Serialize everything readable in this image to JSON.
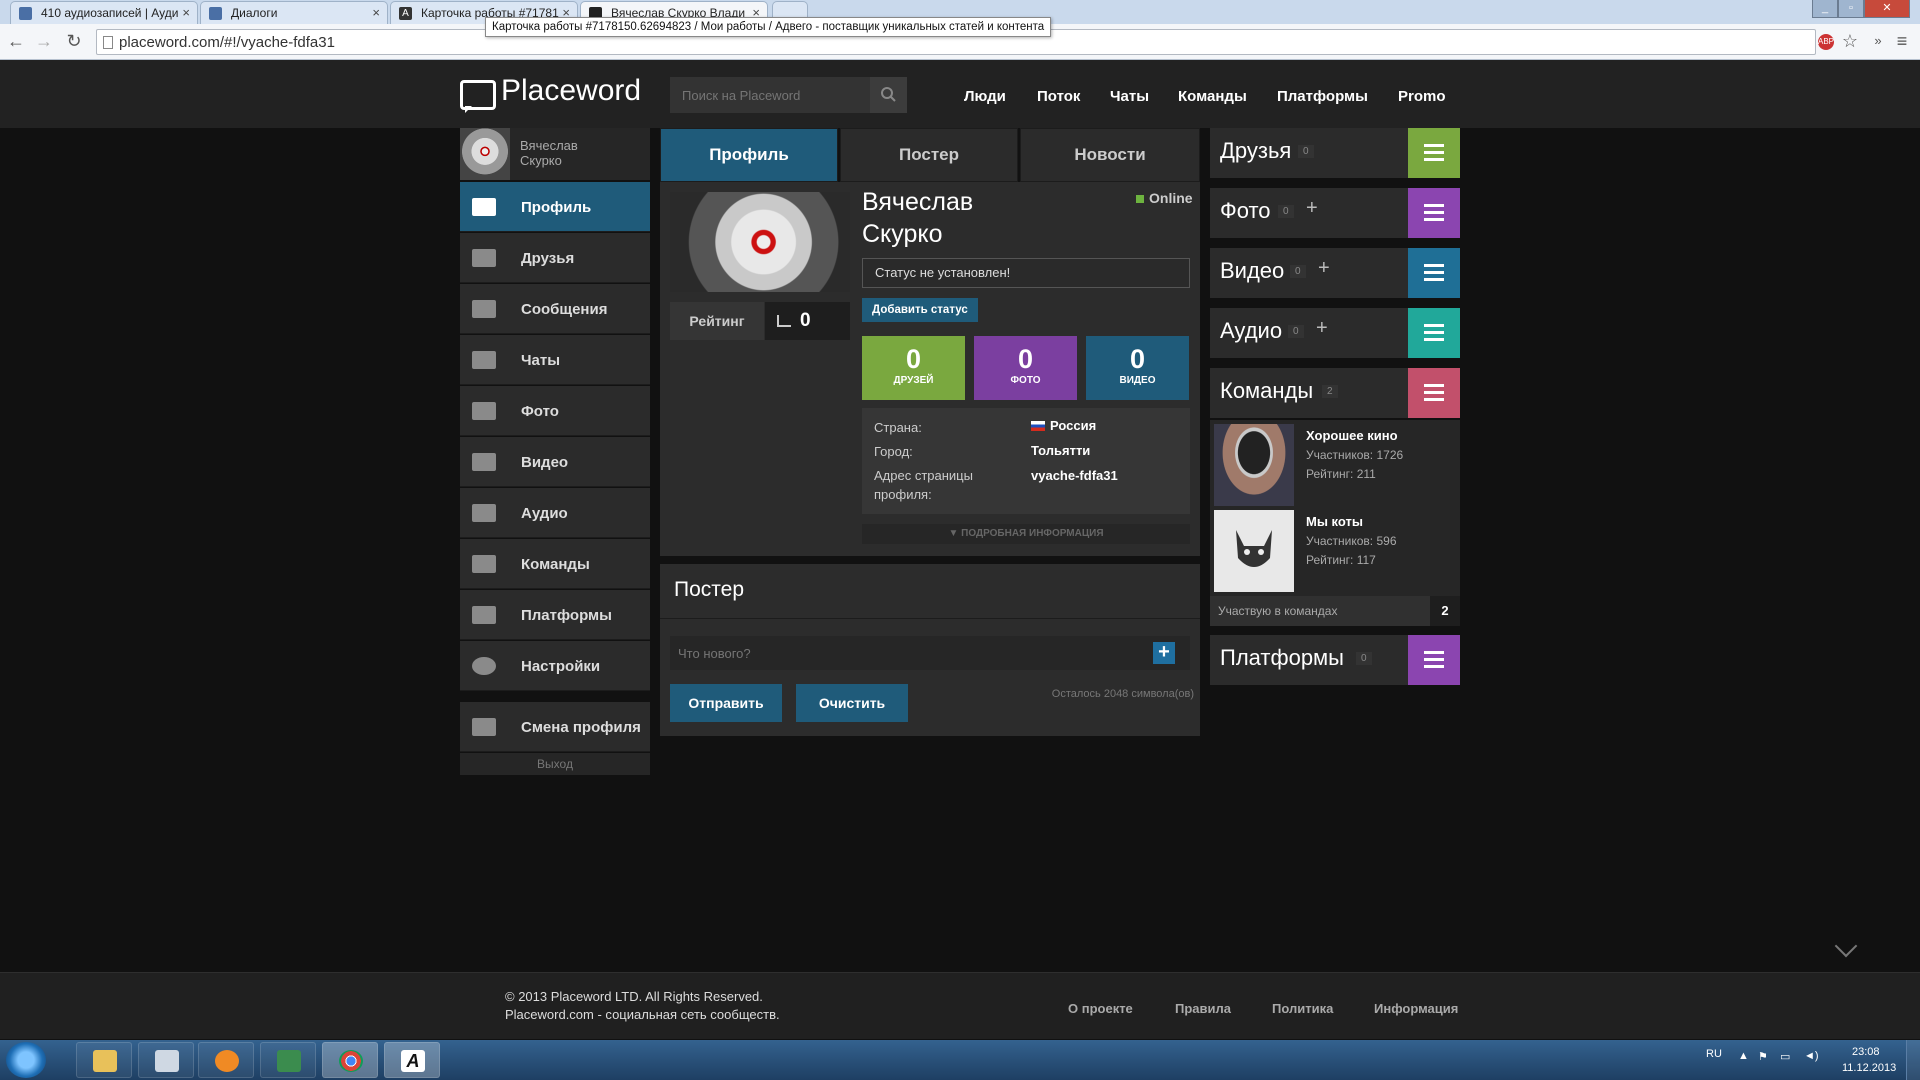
{
  "browser": {
    "tabs": [
      {
        "title": "410 аудиозаписей | Ауди"
      },
      {
        "title": "Диалоги"
      },
      {
        "title": "Карточка работы #71781"
      },
      {
        "title": "Вячеслав Скурко Влади"
      }
    ],
    "tooltip": "Карточка работы #7178150.62694823 / Мои работы / Адвего - поставщик уникальных статей и контента",
    "url": "placeword.com/#!/vyache-fdfa31"
  },
  "header": {
    "logo": "Placeword",
    "search_placeholder": "Поиск на Placeword",
    "nav": [
      "Люди",
      "Поток",
      "Чаты",
      "Команды",
      "Платформы",
      "Promo"
    ]
  },
  "sidebar": {
    "user_name": "Вячеслав Скурко",
    "items": [
      {
        "label": "Профиль",
        "icon": "profile-card-icon"
      },
      {
        "label": "Друзья",
        "icon": "friends-icon"
      },
      {
        "label": "Сообщения",
        "icon": "message-icon"
      },
      {
        "label": "Чаты",
        "icon": "chat-icon"
      },
      {
        "label": "Фото",
        "icon": "photo-icon"
      },
      {
        "label": "Видео",
        "icon": "video-icon"
      },
      {
        "label": "Аудио",
        "icon": "audio-icon"
      },
      {
        "label": "Команды",
        "icon": "teams-icon"
      },
      {
        "label": "Платформы",
        "icon": "platforms-icon"
      },
      {
        "label": "Настройки",
        "icon": "gear-icon"
      }
    ],
    "switch_profile": "Смена профиля",
    "logout": "Выход"
  },
  "main": {
    "tabs": [
      "Профиль",
      "Постер",
      "Новости"
    ],
    "name": "Вячеслав Скурко",
    "online": "Online",
    "rating_label": "Рейтинг",
    "rating_value": "0",
    "status_placeholder": "Статус не установлен!",
    "add_status": "Добавить статус",
    "stats": [
      {
        "value": "0",
        "label": "ДРУЗЕЙ",
        "color": "#7aa83f"
      },
      {
        "value": "0",
        "label": "ФОТО",
        "color": "#7b3fa0"
      },
      {
        "value": "0",
        "label": "ВИДЕО",
        "color": "#1f5b7a"
      }
    ],
    "info": {
      "country_label": "Страна:",
      "country": "Россия",
      "city_label": "Город:",
      "city": "Тольятти",
      "address_label": "Адрес страницы профиля:",
      "address": "vyache-fdfa31"
    },
    "more_info": "ПОДРОБНАЯ ИНФОРМАЦИЯ",
    "poster": {
      "title": "Постер",
      "placeholder": "Что нового?",
      "send": "Отправить",
      "clear": "Очистить",
      "remaining": "Осталось 2048 символа(ов)"
    }
  },
  "right": {
    "boxes": [
      {
        "title": "Друзья",
        "count": "0",
        "plus": false,
        "color": "#7aa83f"
      },
      {
        "title": "Фото",
        "count": "0",
        "plus": true,
        "color": "#8b45b0"
      },
      {
        "title": "Видео",
        "count": "0",
        "plus": true,
        "color": "#1f6f96"
      },
      {
        "title": "Аудио",
        "count": "0",
        "plus": true,
        "color": "#21a89a"
      },
      {
        "title": "Команды",
        "count": "2",
        "plus": false,
        "color": "#c2506b"
      },
      {
        "title": "Платформы",
        "count": "0",
        "plus": false,
        "color": "#8b45b0"
      }
    ],
    "teams": [
      {
        "name": "Хорошее кино",
        "members": "Участников: 1726",
        "rating": "Рейтинг: 211"
      },
      {
        "name": "Мы коты",
        "members": "Участников: 596",
        "rating": "Рейтинг: 117"
      }
    ],
    "teams_footer": "Участвую в командах",
    "teams_footer_count": "2"
  },
  "footer": {
    "copyright": "© 2013 Placeword LTD. All Rights Reserved.",
    "tagline": "Placeword.com - социальная сеть сообществ.",
    "links": [
      "О проекте",
      "Правила",
      "Политика",
      "Информация"
    ]
  },
  "taskbar": {
    "lang": "RU",
    "time": "23:08",
    "date": "11.12.2013"
  }
}
